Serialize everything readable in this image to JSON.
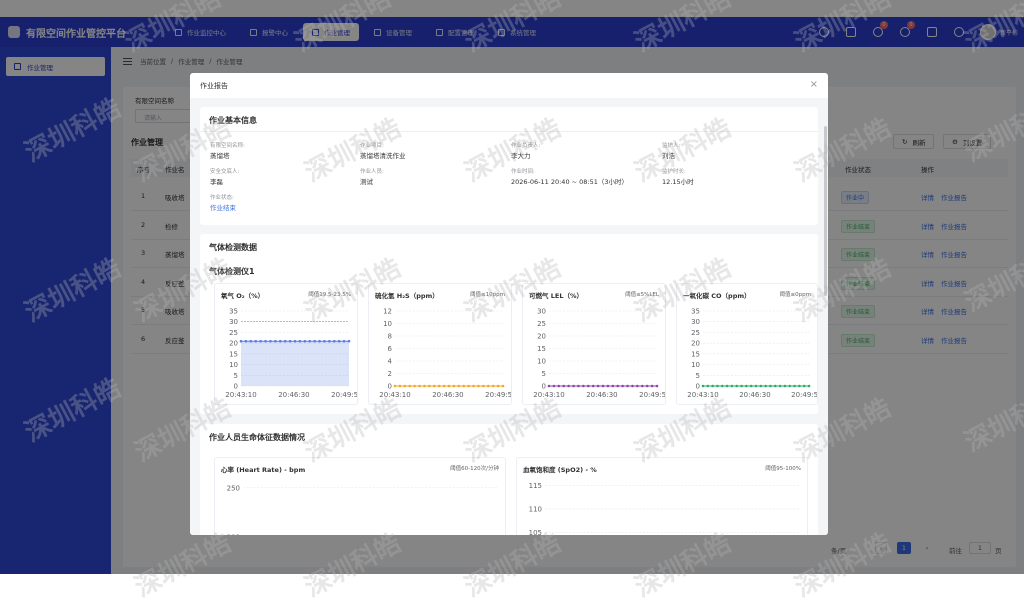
{
  "app": {
    "title": "有限空间作业管控平台",
    "user": "新平彬"
  },
  "nav": [
    {
      "label": "作业监控中心",
      "active": false
    },
    {
      "label": "报警中心",
      "active": false
    },
    {
      "label": "作业管理",
      "active": true
    },
    {
      "label": "设备管理",
      "active": false
    },
    {
      "label": "配置管理",
      "active": false
    },
    {
      "label": "系统管理",
      "active": false
    }
  ],
  "header_badges": {
    "messages": "0",
    "users": "0"
  },
  "sidebar": {
    "items": [
      {
        "label": "作业管理"
      }
    ]
  },
  "breadcrumb": {
    "prefix": "当前位置",
    "level1": "作业管理",
    "level2": "作业管理"
  },
  "filter": {
    "label": "有限空间名称",
    "placeholder": "请输入"
  },
  "list": {
    "title": "作业管理",
    "refresh": "刷新",
    "columns_btn": "列设置",
    "headers": {
      "index": "序号",
      "name": "作业名",
      "status": "作业状态",
      "actions": "操作"
    },
    "rows": [
      {
        "index": "1",
        "name": "吸收塔",
        "status": "作业中",
        "status_type": "blue"
      },
      {
        "index": "2",
        "name": "检修",
        "status": "作业结束",
        "status_type": "green"
      },
      {
        "index": "3",
        "name": "蒸馏塔",
        "status": "作业结束",
        "status_type": "green"
      },
      {
        "index": "4",
        "name": "反应釜",
        "status": "作业结束",
        "status_type": "green"
      },
      {
        "index": "5",
        "name": "吸收塔",
        "status": "作业结束",
        "status_type": "green"
      },
      {
        "index": "6",
        "name": "反应釜",
        "status": "作业结束",
        "status_type": "green"
      }
    ],
    "action_detail": "详情",
    "action_report": "作业报告"
  },
  "pager": {
    "per_page": "条/页",
    "current": "1",
    "goto": "前往",
    "goto_value": "1",
    "page_suffix": "页"
  },
  "modal": {
    "title": "作业报告",
    "basic": {
      "title": "作业基本信息",
      "fields": [
        {
          "label": "有限空间名称:",
          "value": "蒸馏塔"
        },
        {
          "label": "作业项目:",
          "value": "蒸馏塔清洗作业"
        },
        {
          "label": "作业负责人:",
          "value": "李大力"
        },
        {
          "label": "监护人:",
          "value": "刘浩"
        },
        {
          "label": "安全交底人:",
          "value": "李磊"
        },
        {
          "label": "作业人员:",
          "value": "测试"
        },
        {
          "label": "作业时间:",
          "value": "2026-06-11 20:40 ~ 08:51（3小时）"
        },
        {
          "label": "监护时长:",
          "value": "12.15小时"
        },
        {
          "label": "作业状态:",
          "value": "作业结束"
        }
      ]
    },
    "gas": {
      "title": "气体检测数据",
      "device": "气体检测仪1"
    },
    "vitals": {
      "title": "作业人员生命体征数据情况"
    }
  },
  "chart_data": [
    {
      "type": "area",
      "title": "氧气 O₂（%）",
      "threshold_label": "阈值19.5-23.5%",
      "x": [
        "20:43:10",
        "20:46:30",
        "20:49:50"
      ],
      "yticks": [
        0,
        5,
        10,
        15,
        20,
        25,
        30,
        35
      ],
      "ylim": [
        0,
        35
      ],
      "series": [
        {
          "values": [
            20.9,
            20.9,
            20.9,
            20.9,
            20.9,
            20.9,
            20.9,
            20.9,
            20.9,
            20.9,
            20.9,
            20.9,
            20.9,
            20.9,
            20.9,
            20.9,
            20.9,
            20.9,
            20.9,
            20.9,
            20.9,
            20.9,
            20.9
          ]
        }
      ],
      "threshold_line": 30,
      "color": "#5b7ee5"
    },
    {
      "type": "line",
      "title": "硫化氢 H₂S（ppm）",
      "threshold_label": "阈值≤10ppm",
      "x": [
        "20:43:10",
        "20:46:30",
        "20:49:50"
      ],
      "yticks": [
        0,
        2,
        4,
        6,
        8,
        10,
        12
      ],
      "ylim": [
        0,
        12
      ],
      "series": [
        {
          "values": [
            0,
            0,
            0,
            0,
            0,
            0,
            0,
            0,
            0,
            0,
            0,
            0,
            0,
            0,
            0,
            0,
            0,
            0,
            0,
            0,
            0,
            0,
            0
          ]
        }
      ],
      "color": "#f5a623"
    },
    {
      "type": "line",
      "title": "可燃气 LEL（%）",
      "threshold_label": "阈值≤5%LEL",
      "x": [
        "20:43:10",
        "20:46:30",
        "20:49:50"
      ],
      "yticks": [
        0,
        5,
        10,
        15,
        20,
        25,
        30
      ],
      "ylim": [
        0,
        30
      ],
      "series": [
        {
          "values": [
            0,
            0,
            0,
            0,
            0,
            0,
            0,
            0,
            0,
            0,
            0,
            0,
            0,
            0,
            0,
            0,
            0,
            0,
            0,
            0,
            0,
            0,
            0
          ]
        }
      ],
      "color": "#8e44ad"
    },
    {
      "type": "line",
      "title": "一氧化碳 CO（ppm）",
      "threshold_label": "阈值≤0ppm",
      "x": [
        "20:43:10",
        "20:46:30",
        "20:49:50"
      ],
      "yticks": [
        0,
        5,
        10,
        15,
        20,
        25,
        30,
        35
      ],
      "ylim": [
        0,
        35
      ],
      "series": [
        {
          "values": [
            0,
            0,
            0,
            0,
            0,
            0,
            0,
            0,
            0,
            0,
            0,
            0,
            0,
            0,
            0,
            0,
            0,
            0,
            0,
            0,
            0,
            0,
            0
          ]
        }
      ],
      "color": "#27ae60"
    },
    {
      "type": "line",
      "title": "心率 (Heart Rate) - bpm",
      "threshold_label": "阈值60-120次/分钟",
      "yticks": [
        200,
        250
      ],
      "ylim": [
        150,
        260
      ],
      "series": []
    },
    {
      "type": "line",
      "title": "血氧饱和度 (SpO2) - %",
      "threshold_label": "阈值95-100%",
      "yticks": [
        105,
        110,
        115
      ],
      "ylim": [
        100,
        117
      ],
      "series": []
    }
  ],
  "watermark": "深圳科皓"
}
